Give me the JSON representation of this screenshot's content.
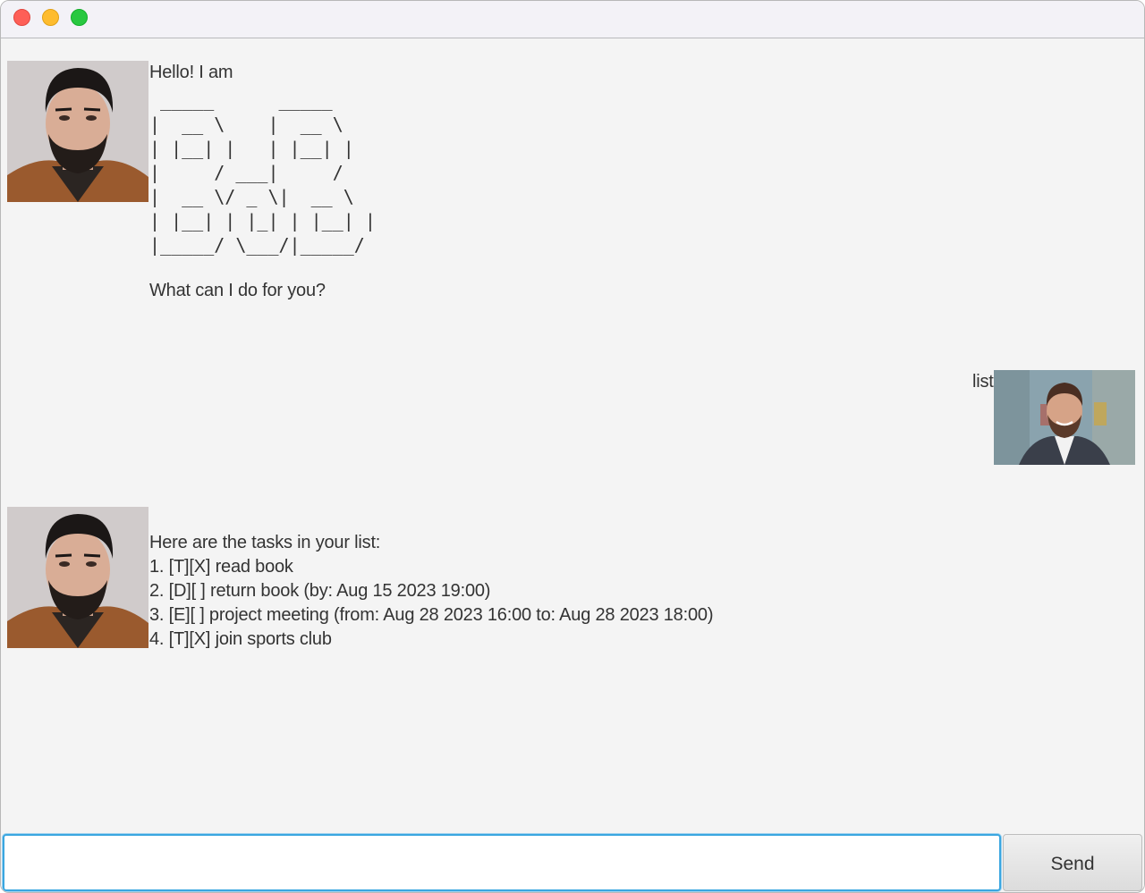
{
  "window": {
    "controls": [
      "close",
      "minimize",
      "maximize"
    ]
  },
  "colors": {
    "background": "#f4f4f4",
    "text": "#333333",
    "input_focus_border": "#3aa6e0",
    "close": "#fe5f57",
    "minimize": "#febc2e",
    "maximize": "#28c840"
  },
  "messages": [
    {
      "sender": "bot",
      "avatar_icon": "bearded-man-brown-jacket-avatar",
      "greeting": "Hello! I am",
      "ascii_logo": " _____      _____\n|  __ \\    |  __ \\\n| |__| |   | |__| |\n|     / ___|     /\n|  __ \\/ _ \\|  __ \\\n| |__| | |_| | |__| |\n|_____/ \\___/|_____/",
      "question": "What can I do for you?"
    },
    {
      "sender": "user",
      "avatar_icon": "smiling-man-suit-avatar",
      "text": "list"
    },
    {
      "sender": "bot",
      "avatar_icon": "bearded-man-brown-jacket-avatar",
      "header": "Here are the tasks in your list:",
      "tasks": [
        "1. [T][X] read book",
        "2. [D][ ] return book (by: Aug 15 2023 19:00)",
        "3. [E][ ] project meeting (from: Aug 28 2023 16:00 to: Aug 28 2023 18:00)",
        "4. [T][X] join sports club"
      ]
    }
  ],
  "input": {
    "value": "",
    "placeholder": ""
  },
  "send_button": {
    "label": "Send"
  }
}
